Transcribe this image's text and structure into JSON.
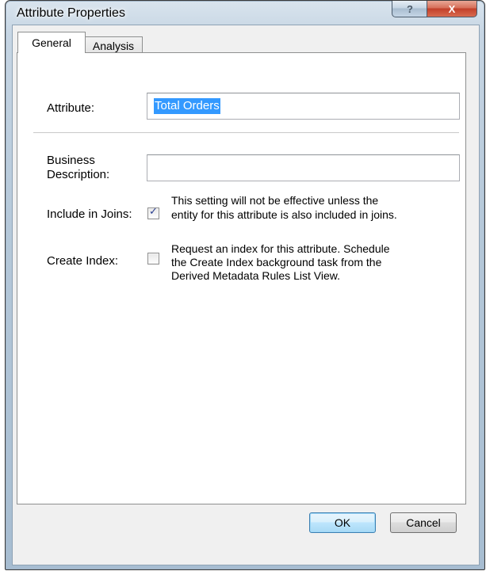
{
  "window": {
    "title": "Attribute Properties",
    "help_glyph": "?",
    "close_glyph": "X"
  },
  "tabs": [
    {
      "label": "General",
      "selected": true
    },
    {
      "label": "Analysis",
      "selected": false
    }
  ],
  "form": {
    "attribute_label": "Attribute:",
    "attribute_value": "Total Orders",
    "business_description_label_line1": "Business",
    "business_description_label_line2": "Description:",
    "business_description_value": "",
    "include_in_joins_label": "Include in Joins:",
    "include_in_joins_checked": true,
    "include_in_joins_note_line1": "This setting will not be effective unless the",
    "include_in_joins_note_line2": "entity for this attribute is also included in joins.",
    "create_index_label": "Create Index:",
    "create_index_checked": false,
    "create_index_note_line1": "Request an index for this attribute. Schedule",
    "create_index_note_line2": "the Create Index background task from the",
    "create_index_note_line3": "Derived Metadata Rules List View."
  },
  "buttons": {
    "ok_label": "OK",
    "cancel_label": "Cancel"
  },
  "colors": {
    "selection": "#3399ff",
    "close_button": "#c2402a",
    "checkmark": "#2a3e90"
  },
  "checkmark_glyph": "✓"
}
